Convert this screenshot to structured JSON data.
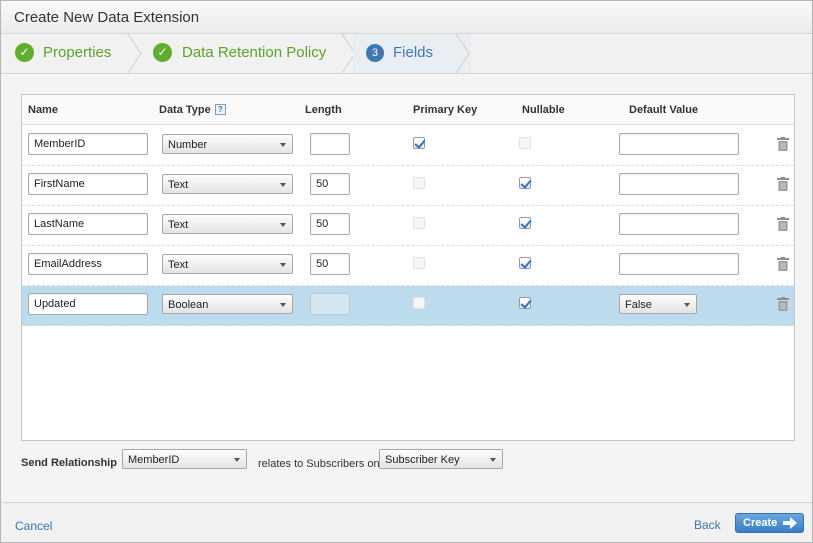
{
  "dialog": {
    "title": "Create New Data Extension"
  },
  "steps": [
    {
      "label": "Properties",
      "state": "done"
    },
    {
      "label": "Data Retention Policy",
      "state": "done"
    },
    {
      "number": "3",
      "label": "Fields",
      "state": "active"
    }
  ],
  "grid": {
    "headers": {
      "name": "Name",
      "data_type": "Data Type",
      "data_type_help": "?",
      "length": "Length",
      "primary_key": "Primary Key",
      "nullable": "Nullable",
      "default_value": "Default Value"
    },
    "rows": [
      {
        "name": "MemberID",
        "data_type": "Number",
        "length": "",
        "primary_key": true,
        "primary_key_enabled": true,
        "nullable": false,
        "nullable_enabled": false,
        "default_value": "",
        "default_type": "input"
      },
      {
        "name": "FirstName",
        "data_type": "Text",
        "length": "50",
        "primary_key": false,
        "primary_key_enabled": false,
        "nullable": true,
        "nullable_enabled": true,
        "default_value": "",
        "default_type": "input"
      },
      {
        "name": "LastName",
        "data_type": "Text",
        "length": "50",
        "primary_key": false,
        "primary_key_enabled": false,
        "nullable": true,
        "nullable_enabled": true,
        "default_value": "",
        "default_type": "input"
      },
      {
        "name": "EmailAddress",
        "data_type": "Text",
        "length": "50",
        "primary_key": false,
        "primary_key_enabled": false,
        "nullable": true,
        "nullable_enabled": true,
        "default_value": "",
        "default_type": "input"
      },
      {
        "name": "Updated",
        "data_type": "Boolean",
        "length": "",
        "primary_key": false,
        "primary_key_enabled": false,
        "nullable": true,
        "nullable_enabled": true,
        "default_value": "False",
        "default_type": "select"
      }
    ],
    "selected_row": 4
  },
  "relationship": {
    "label": "Send Relationship",
    "field": "MemberID",
    "relates_text": "relates to Subscribers on",
    "subscriber_field": "Subscriber Key"
  },
  "footer": {
    "cancel_label": "Cancel",
    "back_label": "Back",
    "create_label": "Create"
  },
  "colors": {
    "accent": "#3e77b1",
    "done": "#5ba32b",
    "selected_row": "#bcdcee",
    "create_button": "#4a8ad0"
  },
  "icons": {
    "done_step": "check-circle-icon",
    "row_delete": "trash-icon",
    "dropdown": "caret-down-icon",
    "create": "arrow-right-icon"
  }
}
